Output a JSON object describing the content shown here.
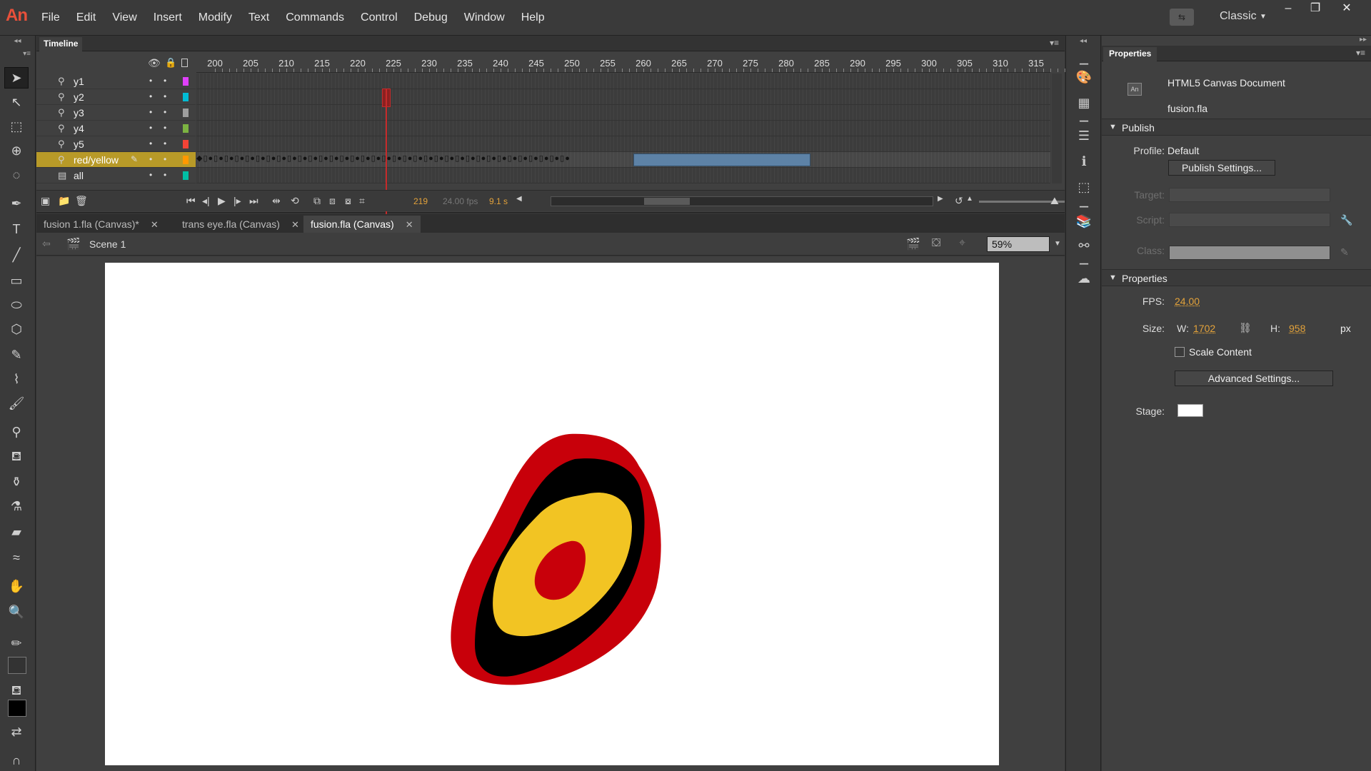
{
  "app": {
    "logo": "An",
    "menu": [
      "File",
      "Edit",
      "View",
      "Insert",
      "Modify",
      "Text",
      "Commands",
      "Control",
      "Debug",
      "Window",
      "Help"
    ],
    "workspace": "Classic",
    "window_buttons": [
      "minimize",
      "restore",
      "close"
    ]
  },
  "timeline": {
    "tab": "Timeline",
    "ruler": [
      "200",
      "205",
      "210",
      "215",
      "220",
      "225",
      "230",
      "235",
      "240",
      "245",
      "250",
      "255",
      "260",
      "265",
      "270",
      "275",
      "280",
      "285",
      "290",
      "295",
      "300",
      "305",
      "310",
      "315"
    ],
    "layers": [
      {
        "name": "y1",
        "color": "#e040fb",
        "icon": "motion-guide-icon"
      },
      {
        "name": "y2",
        "color": "#00bcd4",
        "icon": "motion-guide-icon"
      },
      {
        "name": "y3",
        "color": "#9e9e9e",
        "icon": "motion-guide-icon"
      },
      {
        "name": "y4",
        "color": "#7cb342",
        "icon": "motion-guide-icon"
      },
      {
        "name": "y5",
        "color": "#f44336",
        "icon": "motion-guide-icon"
      },
      {
        "name": "red/yellow",
        "color": "#ff9800",
        "icon": "motion-guide-icon",
        "selected": true
      },
      {
        "name": "all",
        "color": "#00bfa5",
        "icon": "layer-icon"
      }
    ],
    "current_frame": "219",
    "fps": "24.00 fps",
    "elapsed": "9.1 s"
  },
  "documents": {
    "tabs": [
      {
        "label": "fusion 1.fla (Canvas)*",
        "active": false
      },
      {
        "label": "trans eye.fla (Canvas)",
        "active": false
      },
      {
        "label": "fusion.fla (Canvas)",
        "active": true
      }
    ]
  },
  "editbar": {
    "scene": "Scene 1",
    "zoom": "59%"
  },
  "properties": {
    "tab": "Properties",
    "doc_type": "HTML5 Canvas Document",
    "doc_icon": "An",
    "file": "fusion.fla",
    "publish": {
      "header": "Publish",
      "profile_label": "Profile:",
      "profile_value": "Default",
      "settings_button": "Publish Settings...",
      "target_label": "Target:",
      "script_label": "Script:",
      "class_label": "Class:"
    },
    "props": {
      "header": "Properties",
      "fps_label": "FPS:",
      "fps_value": "24.00",
      "size_label": "Size:",
      "w_label": "W:",
      "w_value": "1702",
      "h_label": "H:",
      "h_value": "958",
      "unit": "px",
      "scale_content": "Scale Content",
      "advanced_button": "Advanced Settings...",
      "stage_label": "Stage:",
      "stage_color": "#ffffff"
    }
  },
  "colors": {
    "accent_orange": "#e3a23a",
    "selected_layer": "#b89a28",
    "tween": "#5d82a6",
    "playhead": "#c52a2a",
    "art_red": "#c8000a",
    "art_black": "#000000",
    "art_yellow": "#f2c423"
  }
}
